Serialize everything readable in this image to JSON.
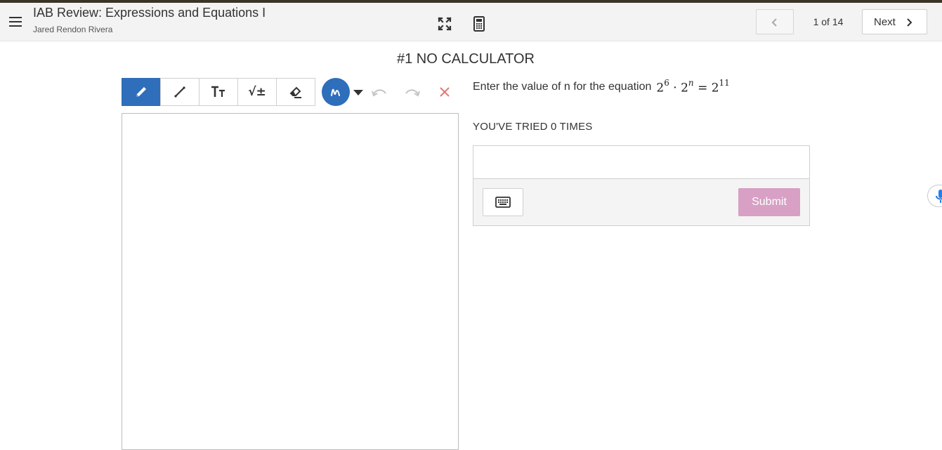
{
  "header": {
    "title": "IAB Review: Expressions and Equations I",
    "student_name": "Jared Rendon Rivera",
    "icons": [
      "menu-icon",
      "expand-icon",
      "calculator-icon",
      "chevron-left-icon",
      "chevron-right-icon"
    ],
    "page_indicator": "1 of 14",
    "next_label": "Next"
  },
  "question": {
    "heading": "#1 NO CALCULATOR",
    "prompt": "Enter the value of n for the equation",
    "equation": {
      "base1": "2",
      "exp1": "6",
      "dot": "·",
      "base2": "2",
      "exp2": "n",
      "equals": "=",
      "base3": "2",
      "exp3": "11"
    },
    "tries_text": "YOU'VE TRIED 0 TIMES",
    "answer_value": "",
    "submit_label": "Submit"
  },
  "drawing_toolbar": {
    "tools": [
      "pencil-icon",
      "line-icon",
      "text-size-icon",
      "math-symbol-icon",
      "eraser-icon"
    ],
    "active_tool": "pencil-icon",
    "math_symbol_glyph": "√±",
    "pen_color": "#2f6eba"
  },
  "colors": {
    "accent": "#2f6eba",
    "submit_disabled": "#d7a0c4",
    "clear_red": "#e57373",
    "header_stripe": "#3a3426",
    "mic_blue": "#2a7de1"
  }
}
